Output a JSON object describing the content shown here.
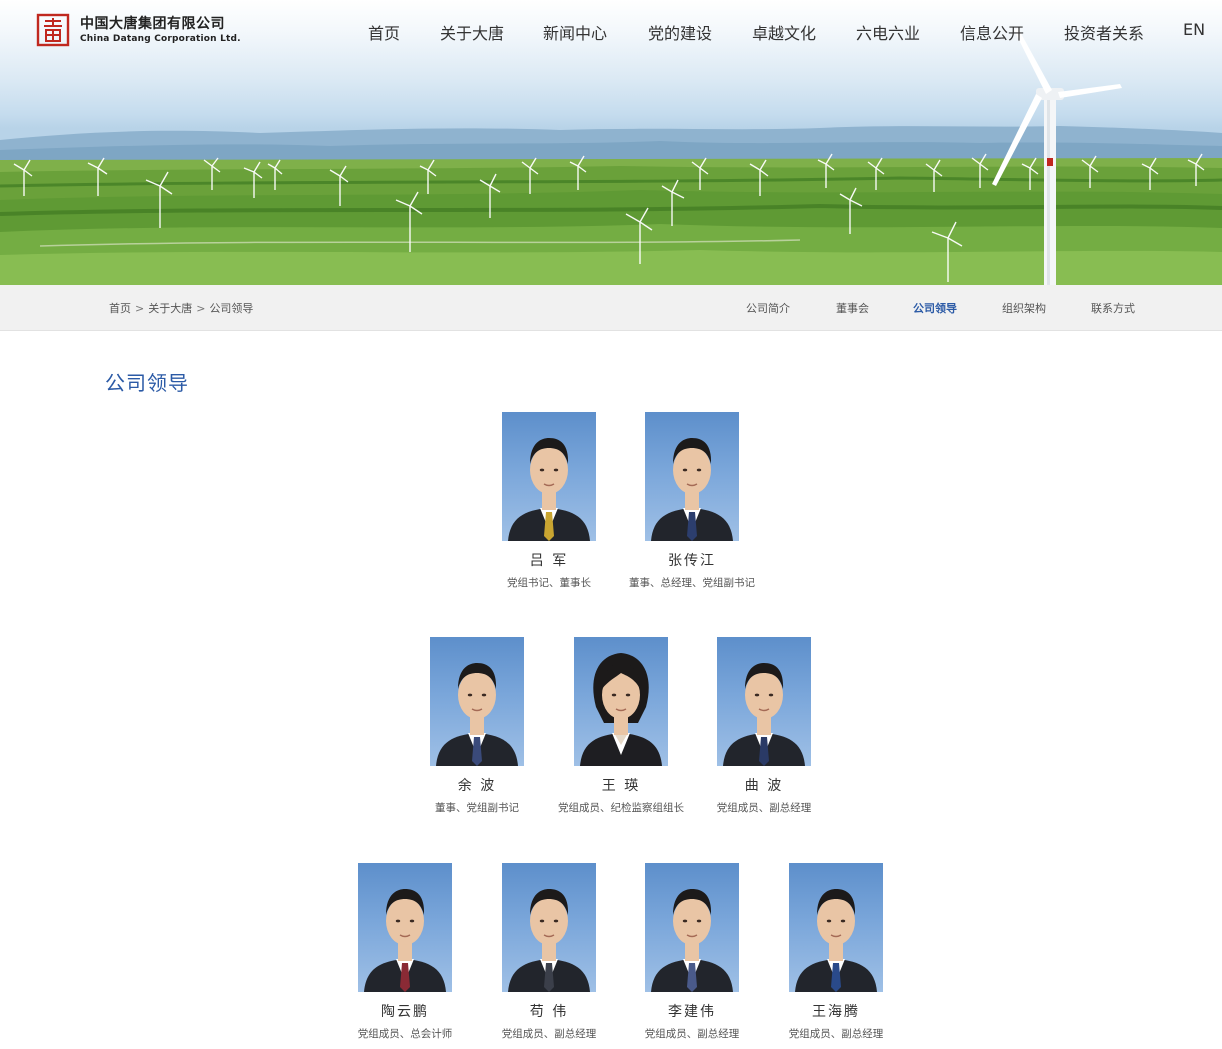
{
  "brand": {
    "name_cn": "中国大唐集团有限公司",
    "name_en": "China Datang Corporation Ltd.",
    "logo_icon": "datang-logo-icon",
    "accent_color": "#c0281f"
  },
  "nav": {
    "items": [
      "首页",
      "关于大唐",
      "新闻中心",
      "党的建设",
      "卓越文化",
      "六电六业",
      "信息公开",
      "投资者关系",
      "EN"
    ]
  },
  "breadcrumb": {
    "items": [
      "首页",
      "关于大唐",
      "公司领导"
    ],
    "separator": ">"
  },
  "subnav": {
    "items": [
      "公司简介",
      "董事会",
      "公司领导",
      "组织架构",
      "联系方式"
    ],
    "active": "公司领导",
    "active_color": "#2b5aa6"
  },
  "page": {
    "title": "公司领导"
  },
  "leaders": [
    {
      "name": "吕 军",
      "role": "党组书记、董事长",
      "tie": "#c9a531"
    },
    {
      "name": "张传江",
      "role": "董事、总经理、党组副书记",
      "tie": "#2c3e6e"
    },
    {
      "name": "余 波",
      "role": "董事、党组副书记",
      "tie": "#3a4a7a"
    },
    {
      "name": "王 瑛",
      "role": "党组成员、纪检监察组组长",
      "tie": ""
    },
    {
      "name": "曲 波",
      "role": "党组成员、副总经理",
      "tie": "#2a3a66"
    },
    {
      "name": "陶云鹏",
      "role": "党组成员、总会计师",
      "tie": "#8a2a35"
    },
    {
      "name": "苟 伟",
      "role": "党组成员、副总经理",
      "tie": "#3b3f4a"
    },
    {
      "name": "李建伟",
      "role": "党组成员、副总经理",
      "tie": "#4a5a8a"
    },
    {
      "name": "王海腾",
      "role": "党组成员、副总经理",
      "tie": "#2a4a8a"
    }
  ]
}
